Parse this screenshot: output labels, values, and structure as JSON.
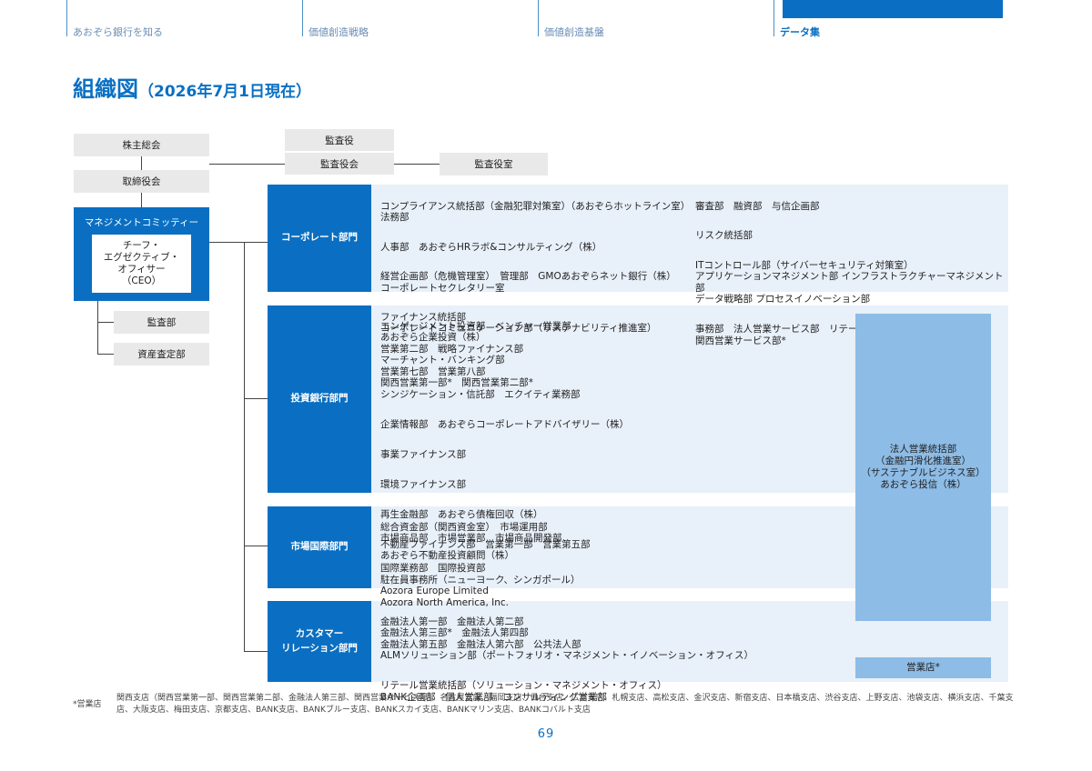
{
  "nav": {
    "items": [
      "あおぞら銀行を知る",
      "価値創造戦略",
      "価値創造基盤",
      "データ集"
    ]
  },
  "title": {
    "main": "組織図",
    "sub": "（2026年7月1日現在）"
  },
  "board": {
    "shareholders": "株主総会",
    "directors": "取締役会",
    "auditor": "監査役",
    "audit_board": "監査役会",
    "audit_office": "監査役室"
  },
  "management": {
    "label": "マネジメントコミッティー",
    "ceo": "チーフ・\nエグゼクティブ・\nオフィサー\n（CEO）",
    "audit_dept": "監査部",
    "asset_dept": "資産査定部"
  },
  "divisions": [
    {
      "name": "コーポレート部門",
      "col1": [
        "コンプライアンス統括部（金融犯罪対策室）（あおぞらホットライン室）\n法務部",
        "人事部　あおぞらHRラボ&コンサルティング（株）",
        "経営企画部（危機管理室）　管理部　GMOあおぞらネット銀行（株）\nコーポレートセクレタリー室",
        "ファイナンス統括部\nコーポレートコミュニケーション部（サステナビリティ推進室）"
      ],
      "col2": [
        "審査部　融資部　与信企画部",
        "リスク統括部",
        "ITコントロール部（サイバーセキュリティ対策室）\nアプリケーションマネジメント部 インフラストラクチャーマネジメント部\nデータ戦略部 プロセスイノベーション部",
        "事務部　法人営業サービス部　リテール営業サービス部　部店業務部\n関西営業サービス部*"
      ]
    },
    {
      "name": "投資銀行部門",
      "col1": [
        "エンゲージメント投資部　ベンチャー営業部\nあおぞら企業投資（株）\n営業第二部　戦略ファイナンス部\nマーチャント・バンキング部\n営業第七部　営業第八部\n関西営業第一部*　関西営業第二部*\nシンジケーション・信託部　エクイティ業務部",
        "企業情報部　あおぞらコーポレートアドバイザリー（株）",
        "事業ファイナンス部",
        "環境ファイナンス部",
        "再生金融部　あおぞら債権回収（株）",
        "不動産ファイナンス部　営業第一部　営業第五部\nあおぞら不動産投資顧問（株）"
      ]
    },
    {
      "name": "市場国際部門",
      "col1": [
        "総合資金部（関西資金室）　市場運用部\n市場商品部　市場営業部　市場商品開発部",
        "国際業務部　国際投資部\n駐在員事務所（ニューヨーク、シンガポール）\nAozora Europe Limited\nAozora North America, Inc."
      ]
    },
    {
      "name": "カスタマー\nリレーション部門",
      "col1": [
        "金融法人第一部　金融法人第二部\n金融法人第三部*　金融法人第四部\n金融法人第五部　金融法人第六部　公共法人部\nALMソリューション部（ポートフォリオ・マネジメント・イノベーション・オフィス）",
        "リテール営業統括部（ソリューション・マネジメント・オフィス）\nBANK企画部　個人営業部　コンサルティング営業部"
      ]
    }
  ],
  "shared": {
    "corporate_sales": "法人営業統括部\n（金融円滑化推進室）\n（サステナブルビジネス室）\nあおぞら投信（株）",
    "branches": "営業店*"
  },
  "footnote": {
    "label": "*営業店",
    "text": "関西支店（関西営業第一部、関西営業第二部、金融法人第三部、関西営業サービス部）、名古屋支店、福岡支店、仙台支店、広島支店、札幌支店、高松支店、金沢支店、新宿支店、日本橋支店、渋谷支店、上野支店、池袋支店、横浜支店、千葉支店、大阪支店、梅田支店、京都支店、BANK支店、BANKブルー支店、BANKスカイ支店、BANKマリン支店、BANKコバルト支店"
  },
  "page_number": "69"
}
